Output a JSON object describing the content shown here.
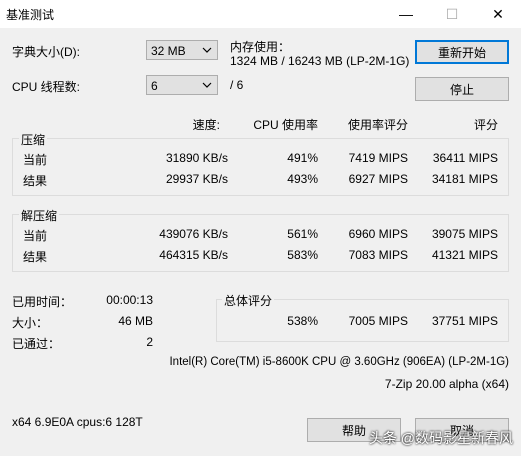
{
  "window": {
    "title": "基准测试",
    "minimize": "—",
    "maximize": "☐",
    "close": "✕"
  },
  "settings": {
    "dict_label": "字典大小(D):",
    "dict_value": "32 MB",
    "threads_label": "CPU 线程数:",
    "threads_value": "6",
    "threads_total": "/ 6",
    "memory_label": "内存使用：",
    "memory_value": "1324 MB / 16243 MB (LP-2M-1G)"
  },
  "buttons": {
    "restart": "重新开始",
    "stop": "停止",
    "help": "帮助",
    "cancel": "取消"
  },
  "columns": {
    "speed": "速度:",
    "cpu_usage": "CPU 使用率",
    "usage_rating": "使用率评分",
    "rating": "评分"
  },
  "compress": {
    "title": "压缩",
    "rows": [
      {
        "label": "当前",
        "speed": "31890 KB/s",
        "cpu": "491%",
        "usage_rating": "7419 MIPS",
        "rating": "36411 MIPS"
      },
      {
        "label": "结果",
        "speed": "29937 KB/s",
        "cpu": "493%",
        "usage_rating": "6927 MIPS",
        "rating": "34181 MIPS"
      }
    ]
  },
  "decompress": {
    "title": "解压缩",
    "rows": [
      {
        "label": "当前",
        "speed": "439076 KB/s",
        "cpu": "561%",
        "usage_rating": "6960 MIPS",
        "rating": "39075 MIPS"
      },
      {
        "label": "结果",
        "speed": "464315 KB/s",
        "cpu": "583%",
        "usage_rating": "7083 MIPS",
        "rating": "41321 MIPS"
      }
    ]
  },
  "stats": {
    "elapsed_label": "已用时间：",
    "elapsed_value": "00:00:13",
    "size_label": "大小：",
    "size_value": "46 MB",
    "passes_label": "已通过：",
    "passes_value": "2"
  },
  "total": {
    "title": "总体评分",
    "cpu": "538%",
    "usage_rating": "7005 MIPS",
    "rating": "37751 MIPS"
  },
  "cpu_info": "Intel(R) Core(TM) i5-8600K CPU @ 3.60GHz (906EA) (LP-2M-1G)",
  "version": "7-Zip 20.00 alpha (x64)",
  "status_line": "x64 6.9E0A cpus:6 128T",
  "watermark": "头条 @数码影星新春风"
}
